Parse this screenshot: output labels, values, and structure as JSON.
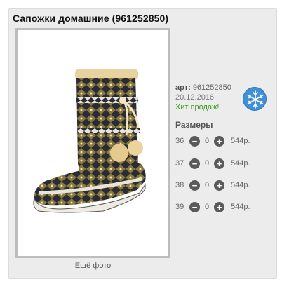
{
  "product": {
    "title": "Сапожки домашние (961252850)",
    "art_label": "арт:",
    "art_value": "961252850",
    "date": "20.12.2016",
    "badge": "Хит продаж!",
    "season_icon": "snowflake-icon",
    "more_photos": "Ещё фото"
  },
  "sizes": {
    "title": "Размеры",
    "minus_symbol": "−",
    "plus_symbol": "+",
    "rows": [
      {
        "size": "36",
        "qty": "0",
        "price": "544р."
      },
      {
        "size": "37",
        "qty": "0",
        "price": "544р."
      },
      {
        "size": "38",
        "qty": "0",
        "price": "544р."
      },
      {
        "size": "39",
        "qty": "0",
        "price": "544р."
      }
    ]
  },
  "colors": {
    "card_bg": "#ececec",
    "frame_border": "#bdbdbd",
    "hit_green": "#3a9a1f",
    "snow_blue": "#3f8fd9",
    "button_gray": "#5a5a5a"
  }
}
